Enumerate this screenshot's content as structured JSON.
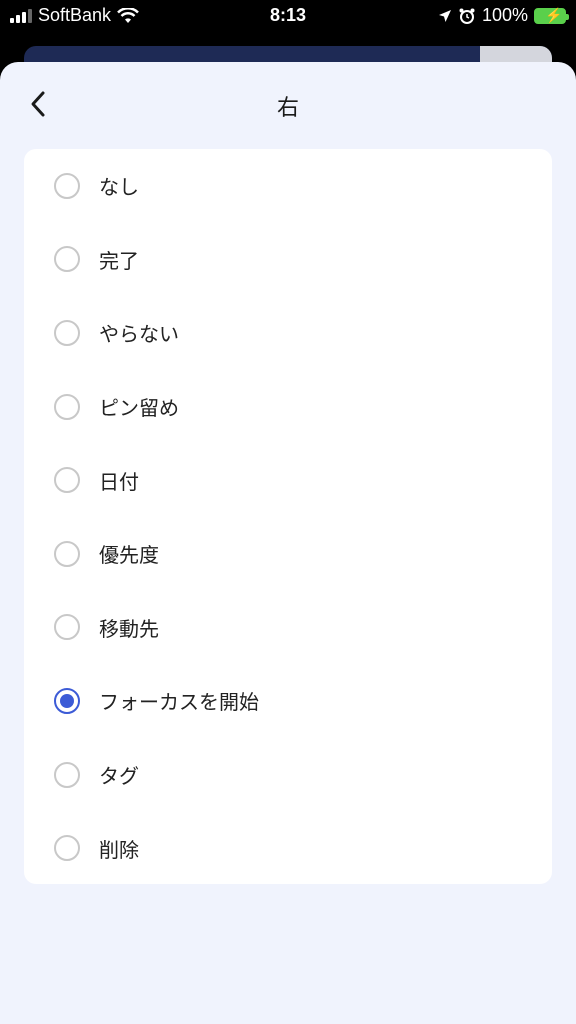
{
  "status_bar": {
    "carrier": "SoftBank",
    "time": "8:13",
    "battery": "100%"
  },
  "header": {
    "title": "右",
    "back_icon": "chevron-left-icon"
  },
  "options": [
    {
      "label": "なし",
      "selected": false
    },
    {
      "label": "完了",
      "selected": false
    },
    {
      "label": "やらない",
      "selected": false
    },
    {
      "label": "ピン留め",
      "selected": false
    },
    {
      "label": "日付",
      "selected": false
    },
    {
      "label": "優先度",
      "selected": false
    },
    {
      "label": "移動先",
      "selected": false
    },
    {
      "label": "フォーカスを開始",
      "selected": true
    },
    {
      "label": "タグ",
      "selected": false
    },
    {
      "label": "削除",
      "selected": false
    }
  ],
  "colors": {
    "accent": "#3c5bd6",
    "sheet_bg": "#f0f3fd"
  }
}
